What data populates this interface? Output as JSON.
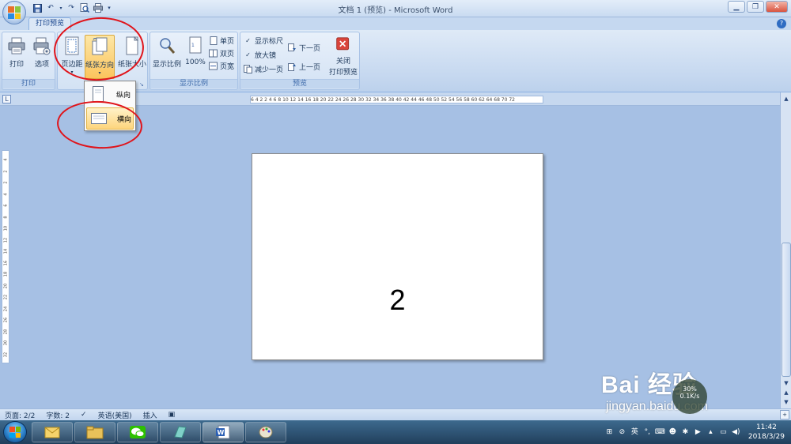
{
  "titlebar": {
    "title": "文档 1 (预览) - Microsoft Word",
    "qat_icons": [
      "save-icon",
      "undo-icon",
      "redo-icon",
      "print-preview-icon",
      "dropdown-icon"
    ],
    "window_buttons": [
      "minimize-icon",
      "maximize-icon",
      "close-icon"
    ]
  },
  "tabs": {
    "active": "打印预览"
  },
  "ribbon": {
    "groups": {
      "print": {
        "label": "打印",
        "print_btn": "打印",
        "options_btn": "选项"
      },
      "page_setup": {
        "margins_btn": "页边距",
        "orientation_btn": "纸张方向",
        "size_btn": "纸张大小"
      },
      "zoom": {
        "label": "显示比例",
        "zoom_btn": "显示比例",
        "hundred_btn": "100%",
        "one_page": "单页",
        "two_pages": "双页",
        "page_width": "页宽"
      },
      "preview": {
        "label": "预览",
        "show_ruler": "显示标尺",
        "magnifier": "放大镜",
        "shrink_one_page": "减少一页",
        "next_page": "下一页",
        "prev_page": "上一页",
        "close_line1": "关闭",
        "close_line2": "打印预览"
      }
    },
    "checkbox_states": {
      "show_ruler": true,
      "magnifier": true
    }
  },
  "dropdown": {
    "portrait": "纵向",
    "landscape": "横向"
  },
  "ruler": {
    "ticks": "6  4  2     2  4  6  8  10 12 14 16 18 20 22 24 26 28 30 32 34 36 38 40 42 44 46 48 50 52 54 56 58 60 62 64    68 70 72",
    "vertical_ticks": [
      "4",
      "2",
      "2",
      "4",
      "6",
      "8",
      "10",
      "12",
      "14",
      "16",
      "18",
      "20",
      "22",
      "24",
      "26",
      "28",
      "30",
      "32"
    ]
  },
  "document": {
    "page_number": "2"
  },
  "watermark": {
    "brand": "Bai 经验",
    "site": "jingyan.baidu.com",
    "speed": "0.1K/s",
    "percent": "30%"
  },
  "status": {
    "page": "页面: 2/2",
    "words": "字数: 2",
    "language": "英语(美国)",
    "insert": "插入"
  },
  "taskbar": {
    "apps": [
      "outlook-icon",
      "explorer-icon",
      "wechat-icon",
      "notebook-icon",
      "word-icon",
      "paint-icon"
    ],
    "tray_lang": "英",
    "time": "11:42",
    "date": "2018/3/29"
  },
  "colors": {
    "ribbon_bg": "#c7d9f0",
    "workspace_bg": "#a6c0e4",
    "annotation_red": "#e0141b",
    "highlight": "#fbc45d",
    "close_button_red": "#d9443b"
  }
}
